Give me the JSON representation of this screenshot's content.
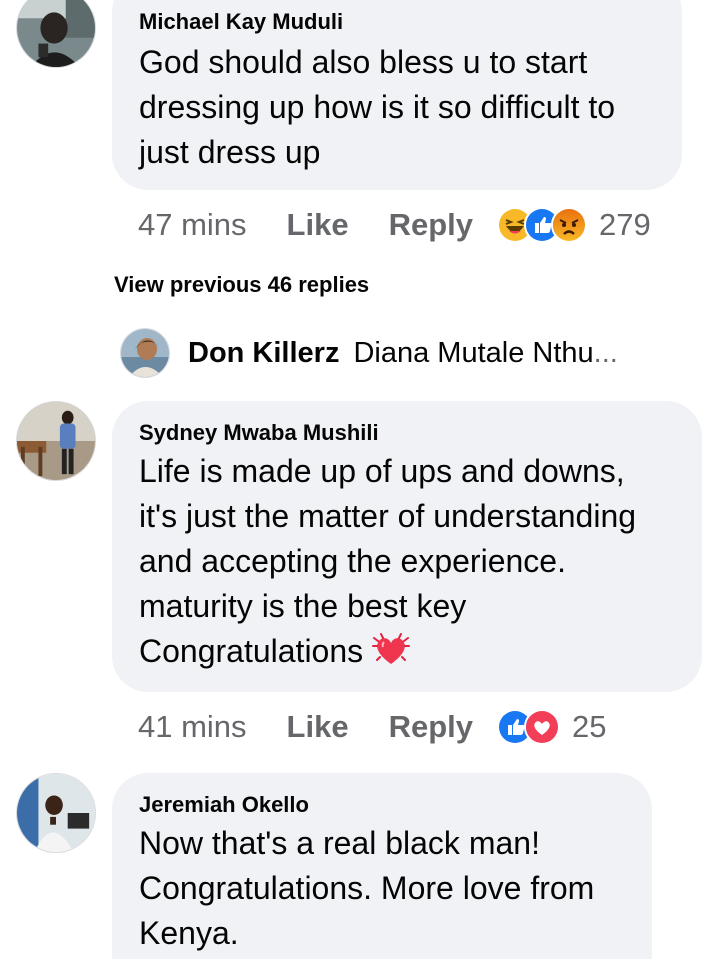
{
  "comments": [
    {
      "author": "Michael Kay Muduli",
      "lines": [
        "God should also bless u to start",
        "dressing up how is it so difficult to",
        "just dress up"
      ],
      "time": "47 mins",
      "like_label": "Like",
      "reply_label": "Reply",
      "reaction_icons": [
        "haha-icon",
        "like-icon",
        "angry-icon"
      ],
      "reaction_count": "279"
    },
    {
      "author": "Sydney Mwaba Mushili",
      "lines": [
        "Life is made up of ups and downs,",
        "it's just the matter of understanding",
        "and accepting the experience.",
        "maturity is the best key",
        "Congratulations"
      ],
      "trailing_emoji": "heartbeat-icon",
      "time": "41 mins",
      "like_label": "Like",
      "reply_label": "Reply",
      "reaction_icons": [
        "like-icon",
        "love-icon"
      ],
      "reaction_count": "25"
    },
    {
      "author": "Jeremiah Okello",
      "lines": [
        "Now that's a real black man!",
        "Congratulations. More love from",
        "Kenya."
      ]
    }
  ],
  "view_previous": "View previous 46 replies",
  "reply_preview": {
    "author": "Don Killerz",
    "text": "Diana Mutale Nthu",
    "ellipsis": "..."
  },
  "colors": {
    "bubble": "#f0f2f5",
    "meta_text": "#65676b",
    "like_blue": "#1877f2",
    "love_red": "#f33e58",
    "haha_yellow": "#f7b928"
  }
}
